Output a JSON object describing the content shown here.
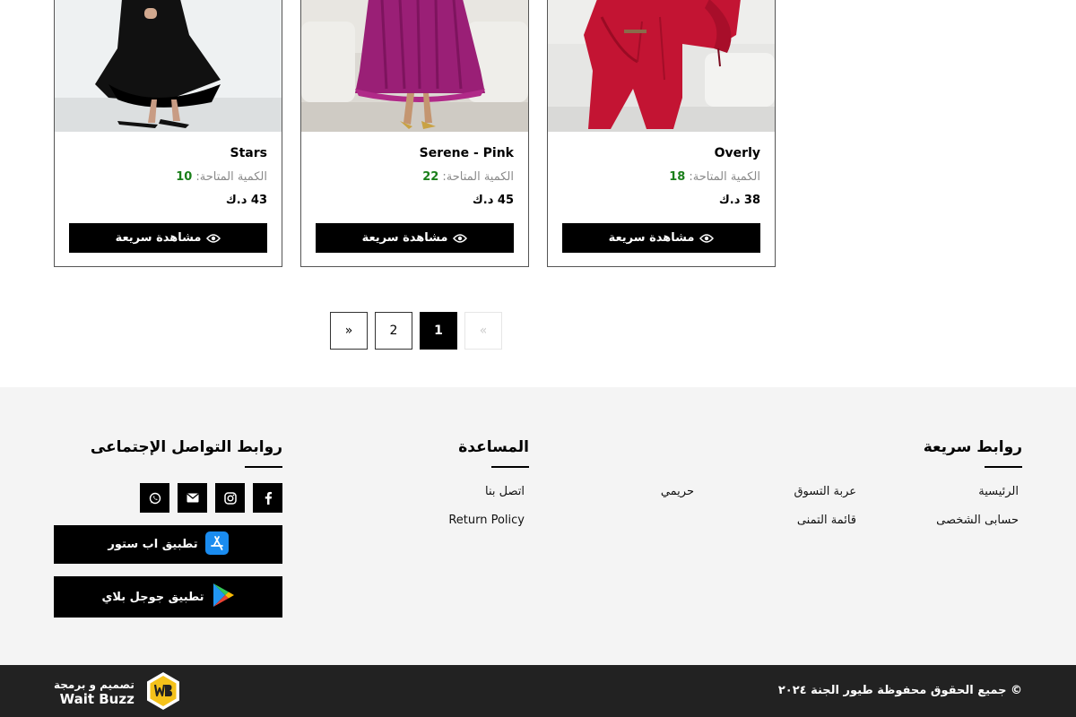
{
  "products": [
    {
      "name": "Stars",
      "stock_label": "الكمية المتاحة:",
      "stock_qty": "10",
      "price": "43 د.ك",
      "quick_view_label": "مشاهدة سريعة",
      "image_color": "black dress"
    },
    {
      "name": "Serene - Pink",
      "stock_label": "الكمية المتاحة:",
      "stock_qty": "22",
      "price": "45 د.ك",
      "quick_view_label": "مشاهدة سريعة",
      "image_color": "magenta dress"
    },
    {
      "name": "Overly",
      "stock_label": "الكمية المتاحة:",
      "stock_qty": "18",
      "price": "38 د.ك",
      "quick_view_label": "مشاهدة سريعة",
      "image_color": "red jumpsuit"
    }
  ],
  "pagination": {
    "next": "»",
    "page_2": "2",
    "page_1": "1",
    "prev": "«",
    "current_page": 1
  },
  "footer": {
    "quick_links": {
      "title": "روابط سريعة",
      "items": [
        "الرئيسية",
        "حسابى الشخصى",
        "عربة التسوق",
        "قائمة التمنى",
        "حريمي"
      ]
    },
    "help": {
      "title": "المساعدة",
      "items": [
        "اتصل بنا",
        "Return Policy"
      ]
    },
    "social": {
      "title": "روابط التواصل الإجتماعى",
      "icons": [
        "facebook-icon",
        "instagram-icon",
        "email-icon",
        "whatsapp-icon"
      ],
      "app_store_label": "تطبيق اب ستور",
      "google_play_label": "تطبيق جوجل بلاي"
    }
  },
  "bottom_bar": {
    "copyright": "© جميع الحقوق محفوظة طيور الجنة ٢٠٢٤",
    "credit_line": "تصميم و برمجة",
    "credit_name": "Wait Buzz"
  },
  "colors": {
    "accent": "#000000",
    "stock_qty": "#1a7f1a",
    "footer_bg": "#f4f4f4",
    "bottom_bar_bg": "#222222"
  }
}
